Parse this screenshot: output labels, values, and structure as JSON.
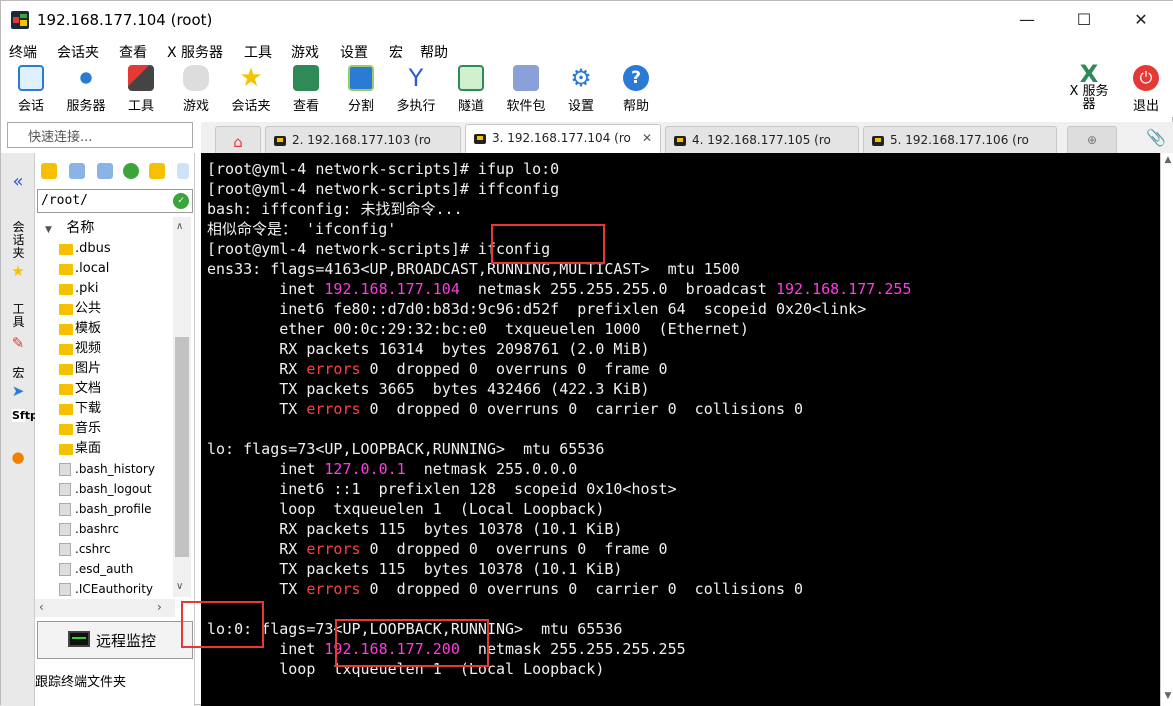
{
  "window": {
    "title": "192.168.177.104 (root)",
    "minimize": "—",
    "maximize": "☐",
    "close": "✕"
  },
  "menu": [
    "终端",
    "会话夹",
    "查看",
    "X 服务器",
    "工具",
    "游戏",
    "设置",
    "宏",
    "帮助"
  ],
  "toolbar": {
    "items": [
      "会话",
      "服务器",
      "工具",
      "游戏",
      "会话夹",
      "查看",
      "分割",
      "多执行",
      "隧道",
      "软件包",
      "设置",
      "帮助"
    ],
    "xserver_label": "X 服务器",
    "exit_label": "退出"
  },
  "quick_connect": {
    "placeholder": "快速连接..."
  },
  "tabs": [
    {
      "label": "2. 192.168.177.103 (ro"
    },
    {
      "label": "3. 192.168.177.104 (ro"
    },
    {
      "label": "4. 192.168.177.105 (ro"
    },
    {
      "label": "5. 192.168.177.106 (ro"
    }
  ],
  "side_tabs": {
    "sessions": "会话夹",
    "tools": "工具",
    "macros": "宏",
    "sftp": "Sftp"
  },
  "filepanel": {
    "path": "/root/",
    "header": "名称",
    "folders": [
      ".dbus",
      ".local",
      ".pki",
      "公共",
      "模板",
      "视频",
      "图片",
      "文档",
      "下载",
      "音乐",
      "桌面"
    ],
    "files": [
      ".bash_history",
      ".bash_logout",
      ".bash_profile",
      ".bashrc",
      ".cshrc",
      ".esd_auth",
      ".ICEauthority"
    ],
    "monitor_label": "远程监控",
    "follow_label": "跟踪终端文件夹"
  },
  "terminal": {
    "lines": [
      [
        {
          "t": "[root@yml-4 network-scripts]# ifup lo:0"
        }
      ],
      [
        {
          "t": "[root@yml-4 network-scripts]# iffconfig"
        }
      ],
      [
        {
          "t": "bash: iffconfig: 未找到命令..."
        }
      ],
      [
        {
          "t": "相似命令是： 'ifconfig'"
        }
      ],
      [
        {
          "t": "[root@yml-4 network-scripts]# ifconfig"
        }
      ],
      [
        {
          "t": "ens33: flags=4163<UP,BROADCAST,RUNNING,MULTICAST>  mtu 1500"
        }
      ],
      [
        {
          "t": "        inet "
        },
        {
          "t": "192.168.177.104",
          "c": "m"
        },
        {
          "t": "  netmask 255.255.255.0  broadcast "
        },
        {
          "t": "192.168.177.255",
          "c": "m"
        }
      ],
      [
        {
          "t": "        inet6 fe80::d7d0:b83d:9c96:d52f  prefixlen 64  scopeid 0x20<link>"
        }
      ],
      [
        {
          "t": "        ether 00:0c:29:32:bc:e0  txqueuelen 1000  (Ethernet)"
        }
      ],
      [
        {
          "t": "        RX packets 16314  bytes 2098761 (2.0 MiB)"
        }
      ],
      [
        {
          "t": "        RX "
        },
        {
          "t": "errors",
          "c": "r"
        },
        {
          "t": " 0  dropped 0  overruns 0  frame 0"
        }
      ],
      [
        {
          "t": "        TX packets 3665  bytes 432466 (422.3 KiB)"
        }
      ],
      [
        {
          "t": "        TX "
        },
        {
          "t": "errors",
          "c": "r"
        },
        {
          "t": " 0  dropped 0 overruns 0  carrier 0  collisions 0"
        }
      ],
      [
        {
          "t": ""
        }
      ],
      [
        {
          "t": "lo: flags=73<UP,LOOPBACK,RUNNING>  mtu 65536"
        }
      ],
      [
        {
          "t": "        inet "
        },
        {
          "t": "127.0.0.1",
          "c": "m"
        },
        {
          "t": "  netmask 255.0.0.0"
        }
      ],
      [
        {
          "t": "        inet6 ::1  prefixlen 128  scopeid 0x10<host>"
        }
      ],
      [
        {
          "t": "        loop  txqueuelen 1  (Local Loopback)"
        }
      ],
      [
        {
          "t": "        RX packets 115  bytes 10378 (10.1 KiB)"
        }
      ],
      [
        {
          "t": "        RX "
        },
        {
          "t": "errors",
          "c": "r"
        },
        {
          "t": " 0  dropped 0  overruns 0  frame 0"
        }
      ],
      [
        {
          "t": "        TX packets 115  bytes 10378 (10.1 KiB)"
        }
      ],
      [
        {
          "t": "        TX "
        },
        {
          "t": "errors",
          "c": "r"
        },
        {
          "t": " 0  dropped 0 overruns 0  carrier 0  collisions 0"
        }
      ],
      [
        {
          "t": ""
        }
      ],
      [
        {
          "t": "lo:0: flags=73<UP,LOOPBACK,RUNNING>  mtu 65536"
        }
      ],
      [
        {
          "t": "        inet "
        },
        {
          "t": "192.168.177.200",
          "c": "m"
        },
        {
          "t": "  netmask 255.255.255.255"
        }
      ],
      [
        {
          "t": "        loop  txqueuelen 1  (Local Loopback)"
        }
      ]
    ]
  },
  "colors": {
    "highlight_box": "#e53935",
    "terminal_bg": "#000000",
    "ip_magenta": "#ff3ce0",
    "error_red": "#ff4040"
  }
}
